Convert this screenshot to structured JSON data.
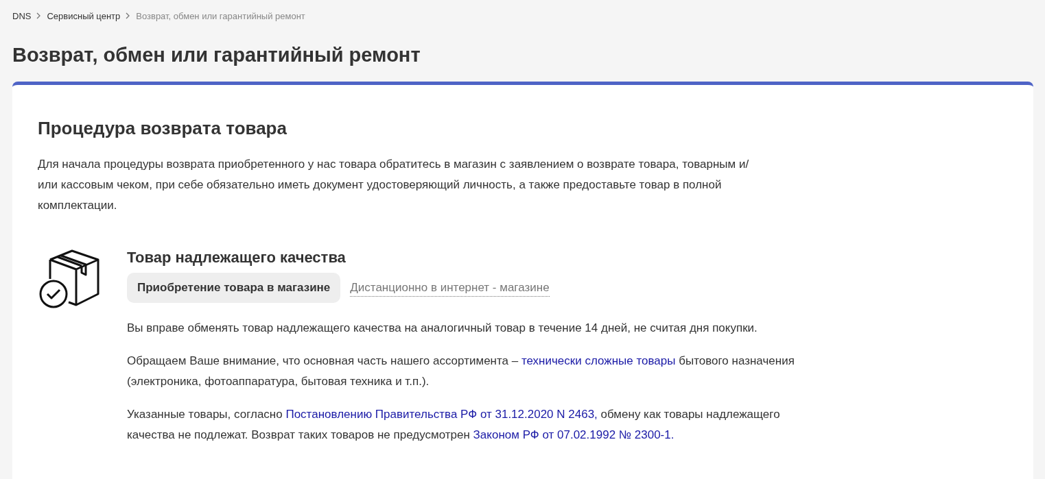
{
  "breadcrumbs": [
    {
      "label": "DNS",
      "current": false
    },
    {
      "label": "Сервисный центр",
      "current": false
    },
    {
      "label": "Возврат, обмен или гарантийный ремонт",
      "current": true
    }
  ],
  "page_title": "Возврат, обмен или гарантийный ремонт",
  "card": {
    "heading": "Процедура возврата товара",
    "intro": "Для начала процедуры возврата приобретенного у нас товара обратитесь в магазин с заявлением о возврате товара, товарным и/или кассовым чеком, при себе обязательно иметь документ удостоверяющий личность, а также предоставьте товар в полной комплектации.",
    "section": {
      "title": "Товар надлежащего качества",
      "tabs": [
        {
          "label": "Приобретение товара в магазине",
          "selected": true
        },
        {
          "label": "Дистанционно в интернет - магазине",
          "selected": false
        }
      ],
      "paragraphs": [
        [
          {
            "kind": "text",
            "text": "Вы вправе обменять товар надлежащего качества на аналогичный товар в течение 14 дней, не считая дня покупки."
          }
        ],
        [
          {
            "kind": "text",
            "text": "Обращаем Ваше внимание, что основная часть нашего ассортимента – "
          },
          {
            "kind": "link",
            "text": "технически сложные товары"
          },
          {
            "kind": "text",
            "text": " бытового назначения (электроника, фотоаппаратура, бытовая техника и т.п.)."
          }
        ],
        [
          {
            "kind": "text",
            "text": "Указанные товары, согласно "
          },
          {
            "kind": "link",
            "text": "Постановлению Правительства РФ от 31.12.2020 N 2463,"
          },
          {
            "kind": "text",
            "text": " обмену как товары надлежащего качества не подлежат. Возврат таких товаров не предусмотрен "
          },
          {
            "kind": "link",
            "text": "Законом РФ от 07.02.1992 № 2300-1."
          }
        ]
      ]
    }
  }
}
